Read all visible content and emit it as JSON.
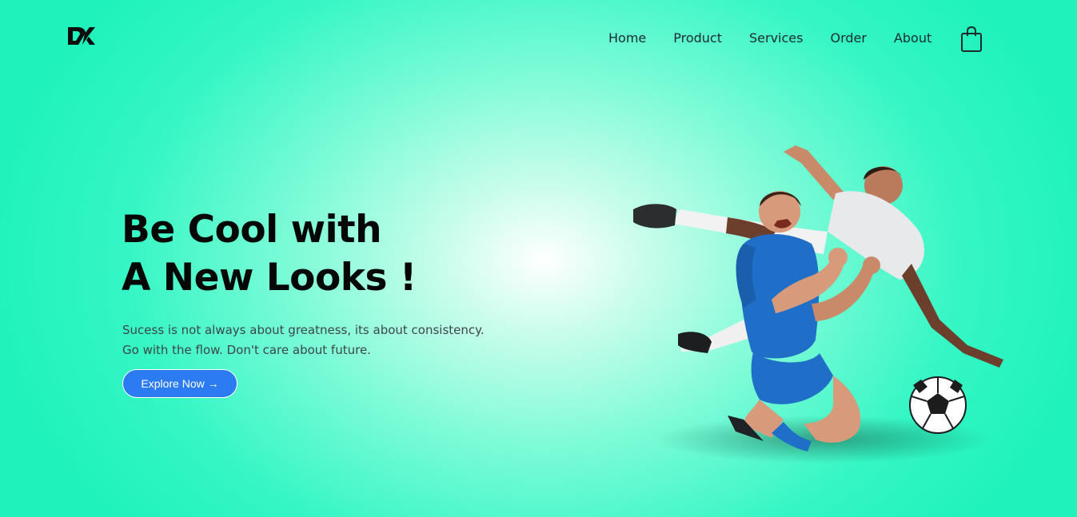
{
  "header": {
    "nav": [
      {
        "label": "Home"
      },
      {
        "label": "Product"
      },
      {
        "label": "Services"
      },
      {
        "label": "Order"
      },
      {
        "label": "About"
      }
    ],
    "cart_icon": "shopping-bag-icon",
    "logo_icon": "dk-logo"
  },
  "hero": {
    "title_line1": "Be Cool with",
    "title_line2": "A New Looks !",
    "subtitle_line1": "Sucess is not always about greatness, its about consistency.",
    "subtitle_line2": "Go with the flow. Don't care about future.",
    "cta_label": "Explore Now →",
    "image": "football-players-image"
  },
  "colors": {
    "background": "#34f6c4",
    "accent": "#2b7cf2",
    "text": "#050707"
  }
}
